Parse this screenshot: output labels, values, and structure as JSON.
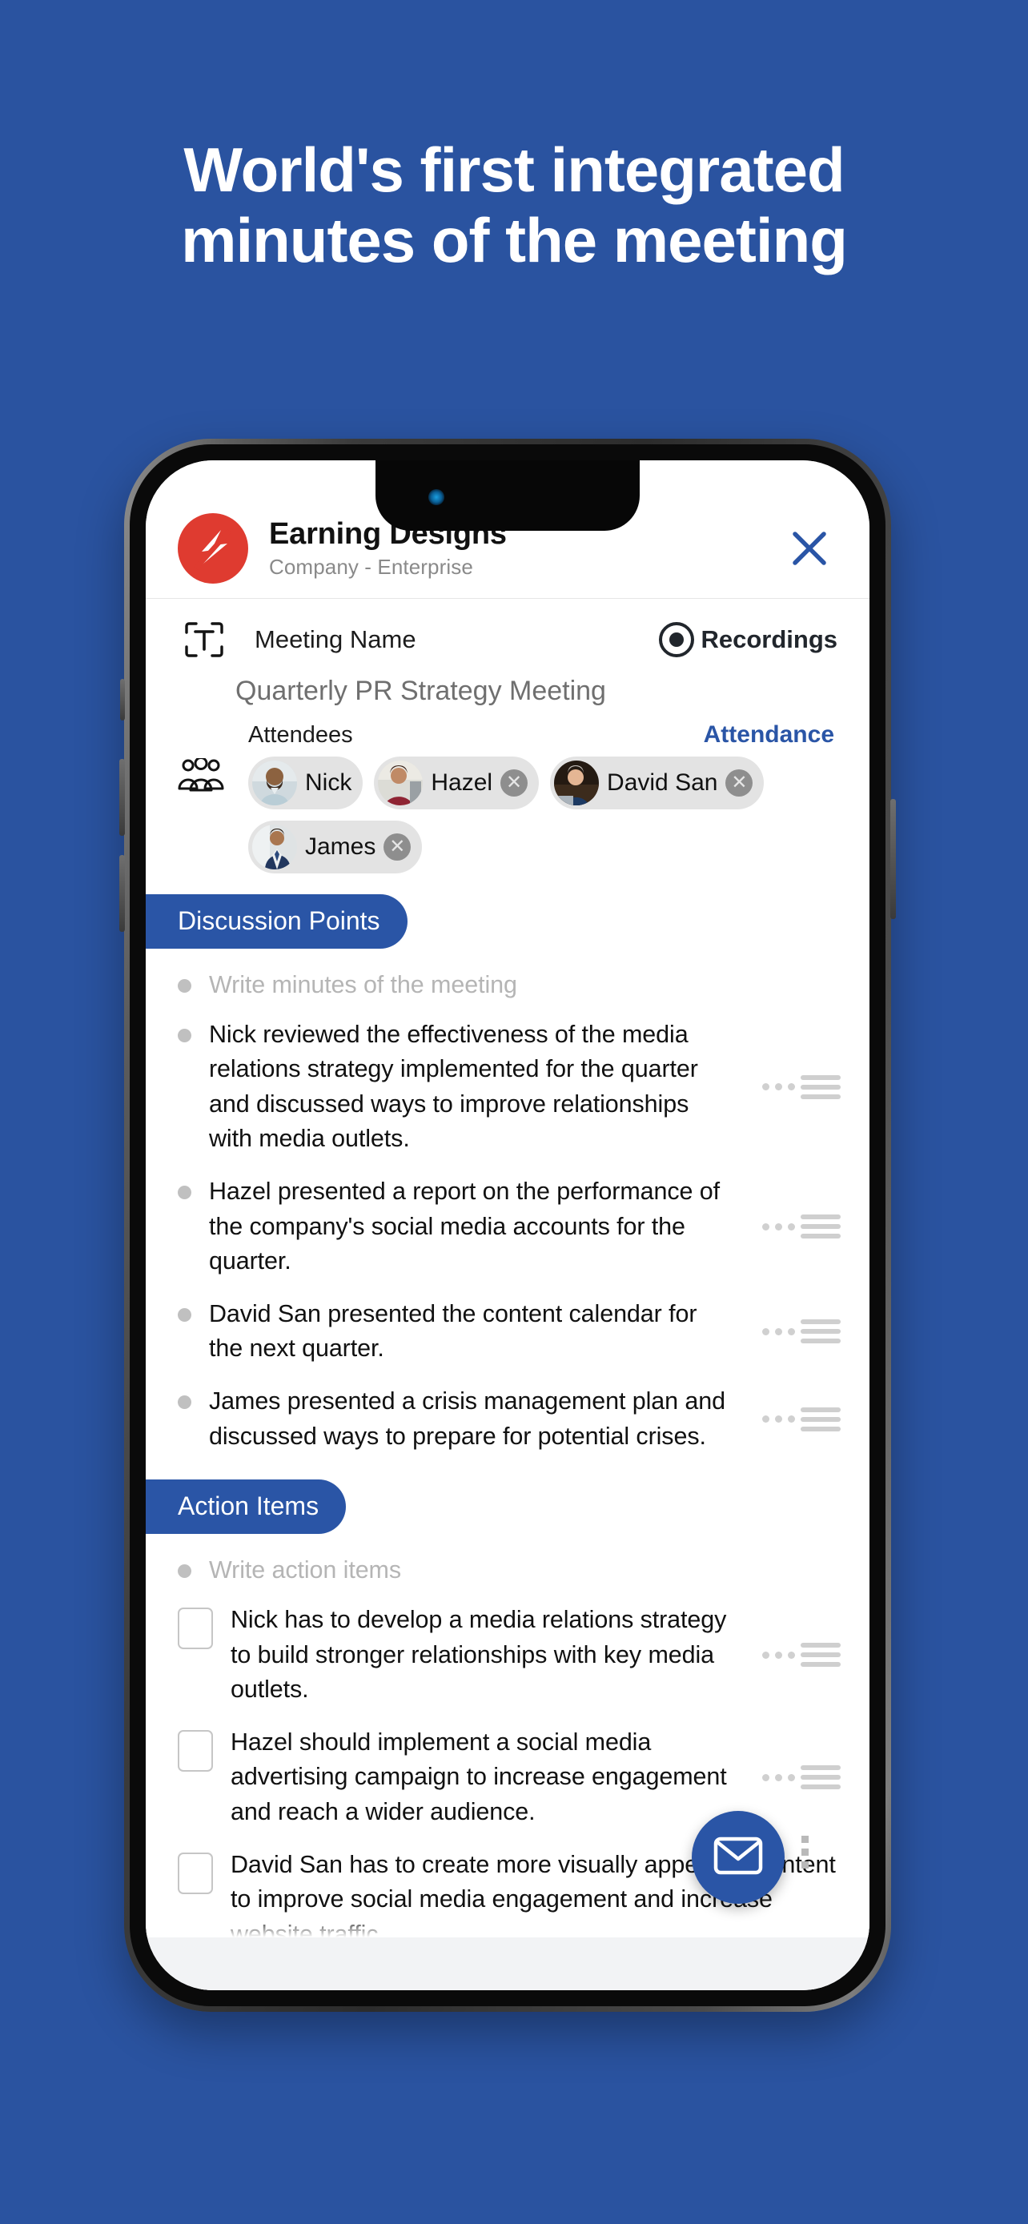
{
  "hero": {
    "line1": "World's first integrated",
    "line2": "minutes of the meeting"
  },
  "colors": {
    "background": "#2a53a0",
    "accent": "#2a55a6",
    "logo": "#df3b30",
    "chip": "#e3e3e3",
    "placeholder_text": "#b5b5b5"
  },
  "app": {
    "header": {
      "title": "Earning Designs",
      "subtitle": "Company - Enterprise",
      "logo_icon": "earning-designs-logo",
      "close_icon": "close-icon"
    },
    "meeting": {
      "text_icon": "text-field-icon",
      "label": "Meeting Name",
      "value": "Quarterly PR Strategy Meeting",
      "recordings_label": "Recordings",
      "recordings_icon": "record-dot-icon"
    },
    "attendees": {
      "icon": "people-group-icon",
      "label": "Attendees",
      "link_label": "Attendance",
      "chips": [
        {
          "name": "Nick",
          "removable": false,
          "remove_icon": ""
        },
        {
          "name": "Hazel",
          "removable": true,
          "remove_icon": "remove-icon"
        },
        {
          "name": "David San",
          "removable": true,
          "remove_icon": "remove-icon"
        },
        {
          "name": "James",
          "removable": true,
          "remove_icon": "remove-icon"
        }
      ]
    },
    "discussion": {
      "badge_label": "Discussion Points",
      "placeholder": "Write minutes of the meeting",
      "drag_handle_icon": "drag-handle-icon",
      "items": [
        "Nick reviewed the effectiveness of the media relations strategy implemented for the quarter and discussed ways to improve relationships with media outlets.",
        "Hazel presented a report on the performance of the company's social media accounts for the quarter.",
        "David San presented the content calendar for the next quarter.",
        "James presented a crisis management plan and discussed ways to prepare for potential crises."
      ]
    },
    "actions": {
      "badge_label": "Action Items",
      "placeholder": "Write action items",
      "items": [
        "Nick has to develop a media relations strategy to build stronger relationships with key media outlets.",
        "Hazel should implement a social media advertising campaign to increase engagement and reach a wider audience.",
        "David San has to create more visually appealing content to improve social media engagement and increase website traffic."
      ]
    },
    "fab": {
      "icon": "envelope-icon",
      "more_icon": "more-vertical-icon"
    }
  }
}
